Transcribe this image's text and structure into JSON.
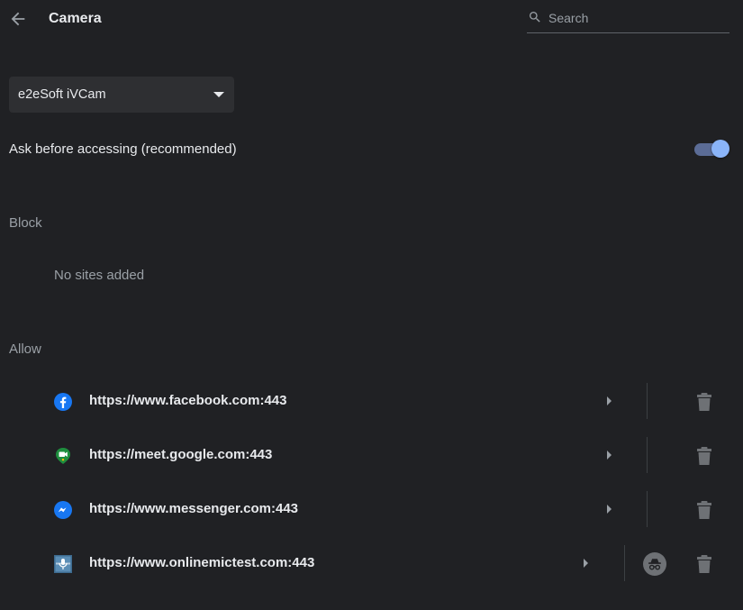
{
  "header": {
    "title": "Camera",
    "search_placeholder": "Search"
  },
  "device": {
    "selected": "e2eSoft iVCam"
  },
  "ask_setting": {
    "label": "Ask before accessing (recommended)",
    "enabled": true
  },
  "block": {
    "title": "Block",
    "empty_message": "No sites added"
  },
  "allow": {
    "title": "Allow",
    "sites": [
      {
        "url": "https://www.facebook.com:443",
        "favicon": "facebook-icon"
      },
      {
        "url": "https://meet.google.com:443",
        "favicon": "google-meet-icon"
      },
      {
        "url": "https://www.messenger.com:443",
        "favicon": "messenger-icon"
      },
      {
        "url": "https://www.onlinemictest.com:443",
        "favicon": "onlinemictest-icon",
        "incognito": true
      }
    ]
  },
  "colors": {
    "background": "#202124",
    "accent": "#8ab4f8",
    "text_primary": "#e8eaed",
    "text_secondary": "#9aa0a6"
  }
}
